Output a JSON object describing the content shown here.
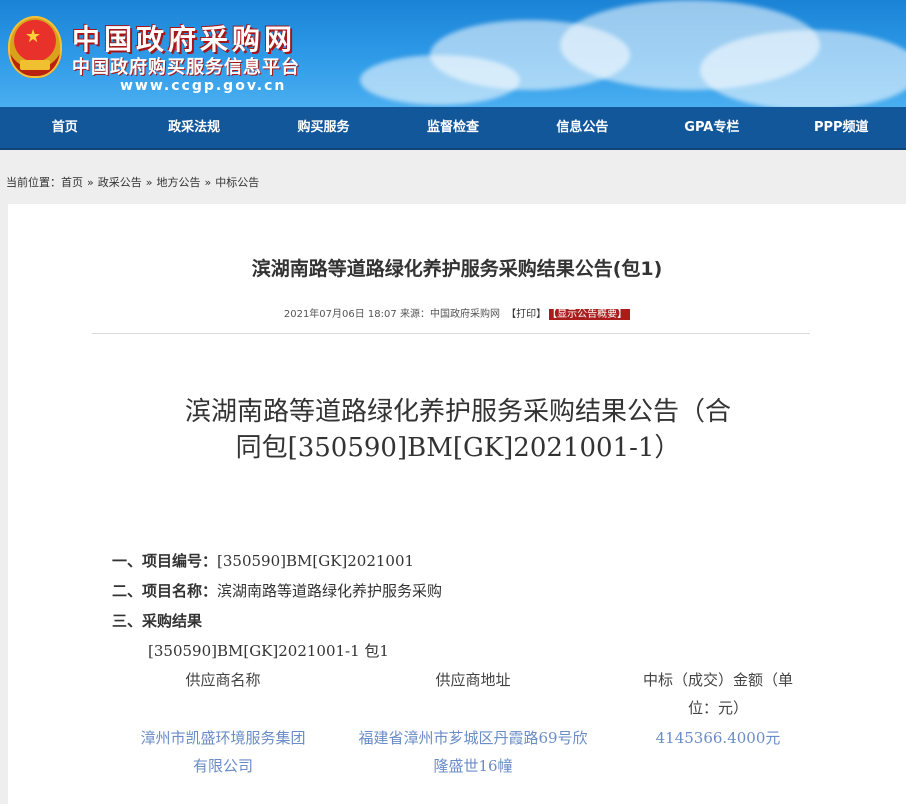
{
  "header": {
    "title": "中国政府采购网",
    "subtitle": "中国政府购买服务信息平台",
    "url": "www.ccgp.gov.cn"
  },
  "nav": {
    "items": [
      "首页",
      "政采法规",
      "购买服务",
      "监督检查",
      "信息公告",
      "GPA专栏",
      "PPP频道"
    ]
  },
  "breadcrumb": {
    "prefix": "当前位置：",
    "items": [
      "首页",
      "政采公告",
      "地方公告",
      "中标公告"
    ],
    "separator": "»"
  },
  "article": {
    "title": "滨湖南路等道路绿化养护服务采购结果公告(包1)",
    "date": "2021年07月06日 18:07",
    "source_label": "来源：",
    "source": "中国政府采购网",
    "print_label": "【打印】",
    "summary_label": "【显示公告概要】",
    "heading_line1": "滨湖南路等道路绿化养护服务采购结果公告（合",
    "heading_line2": "同包[350590]BM[GK]2021001-1）",
    "s1_label": "一、项目编号：",
    "s1_value": "[350590]BM[GK]2021001",
    "s2_label": "二、项目名称：",
    "s2_value": "滨湖南路等道路绿化养护服务采购",
    "s3_label": "三、采购结果",
    "package": "[350590]BM[GK]2021001-1 包1",
    "columns": [
      "供应商名称",
      "供应商地址",
      "中标（成交）金额（单位：元）"
    ],
    "columns_split": {
      "c3_line1": "中标（成交）金额（单",
      "c3_line2": "位：元）"
    },
    "row": {
      "name_line1": "漳州市凯盛环境服务集团",
      "name_line2": "有限公司",
      "addr_line1": "福建省漳州市芗城区丹霞路69号欣",
      "addr_line2": "隆盛世16幢",
      "amount": "4145366.4000元"
    }
  },
  "colors": {
    "nav_bg": "#13579b",
    "summary_bg": "#a91d1d",
    "link": "#6a8cc7"
  }
}
